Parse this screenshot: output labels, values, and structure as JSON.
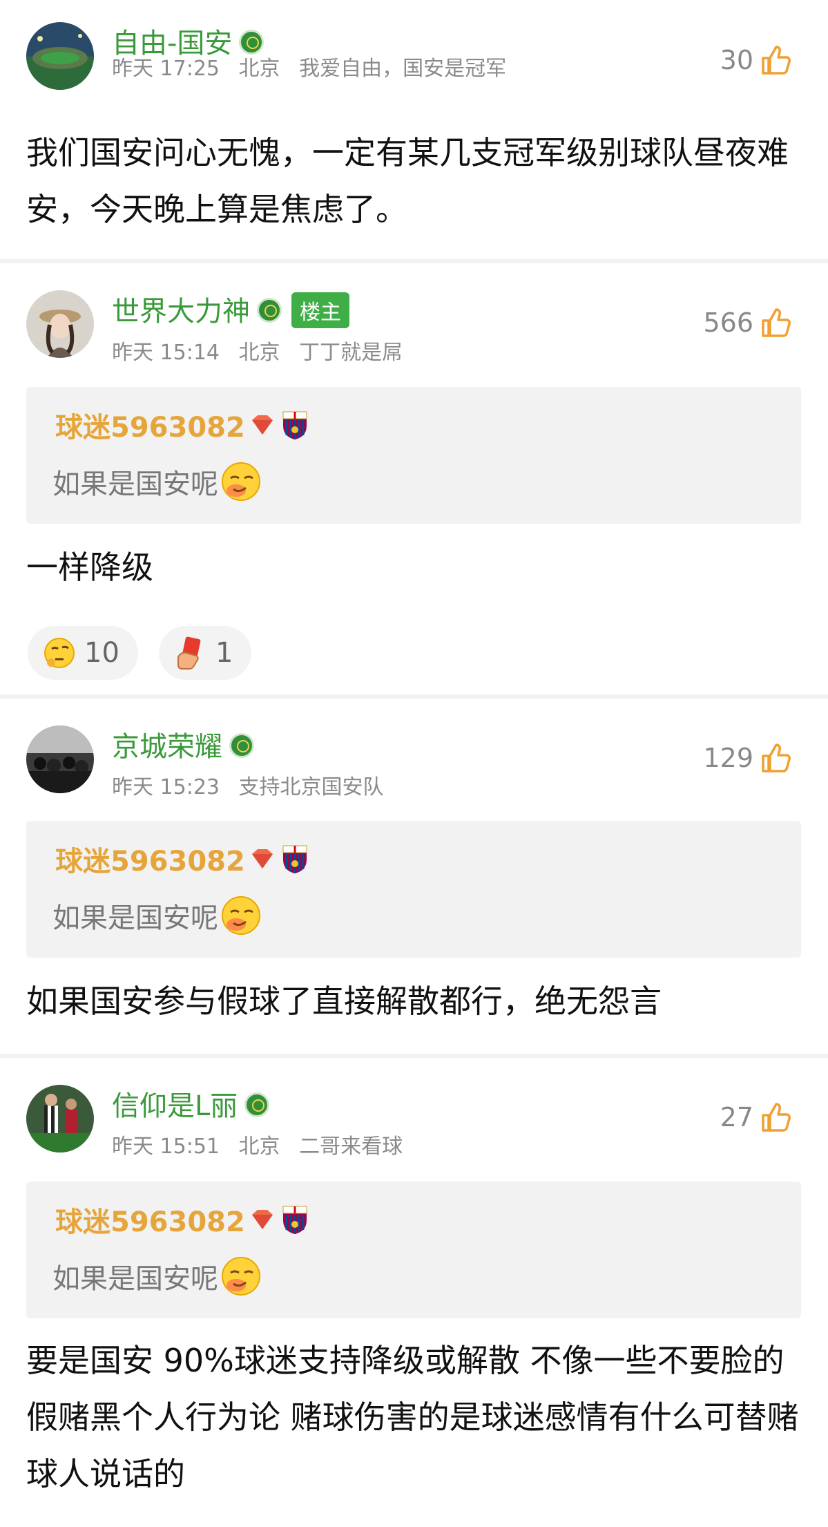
{
  "comments": [
    {
      "username": "自由-国安",
      "time": "昨天 17:25",
      "location": "北京",
      "signature": "我爱自由，国安是冠军",
      "likes": "30",
      "text": "我们国安问心无愧，一定有某几支冠军级别球队昼夜难安，今天晚上算是焦虑了。"
    },
    {
      "username": "世界大力神",
      "op_tag": "楼主",
      "time": "昨天 15:14",
      "location": "北京",
      "signature": "丁丁就是屌",
      "likes": "566",
      "quote_user": "球迷5963082",
      "quote_text": "如果是国安呢",
      "text": "一样降级",
      "reactions": [
        {
          "icon": "thinking-emoji",
          "count": "10"
        },
        {
          "icon": "red-card-hand-emoji",
          "count": "1"
        }
      ]
    },
    {
      "username": "京城荣耀",
      "time": "昨天 15:23",
      "signature": "支持北京国安队",
      "likes": "129",
      "quote_user": "球迷5963082",
      "quote_text": "如果是国安呢",
      "text": "如果国安参与假球了直接解散都行，绝无怨言"
    },
    {
      "username": "信仰是L丽",
      "time": "昨天 15:51",
      "location": "北京",
      "signature": "二哥来看球",
      "likes": "27",
      "quote_user": "球迷5963082",
      "quote_text": "如果是国安呢",
      "text": "要是国安 90%球迷支持降级或解散 不像一些不要脸的假赌黑个人行为论 赌球伤害的是球迷感情有什么可替赌球人说话的"
    }
  ],
  "colors": {
    "username": "#3a9a3a",
    "quote_user": "#e6a53a",
    "op_tag_bg": "#3fae46",
    "like_icon": "#f0a030"
  }
}
